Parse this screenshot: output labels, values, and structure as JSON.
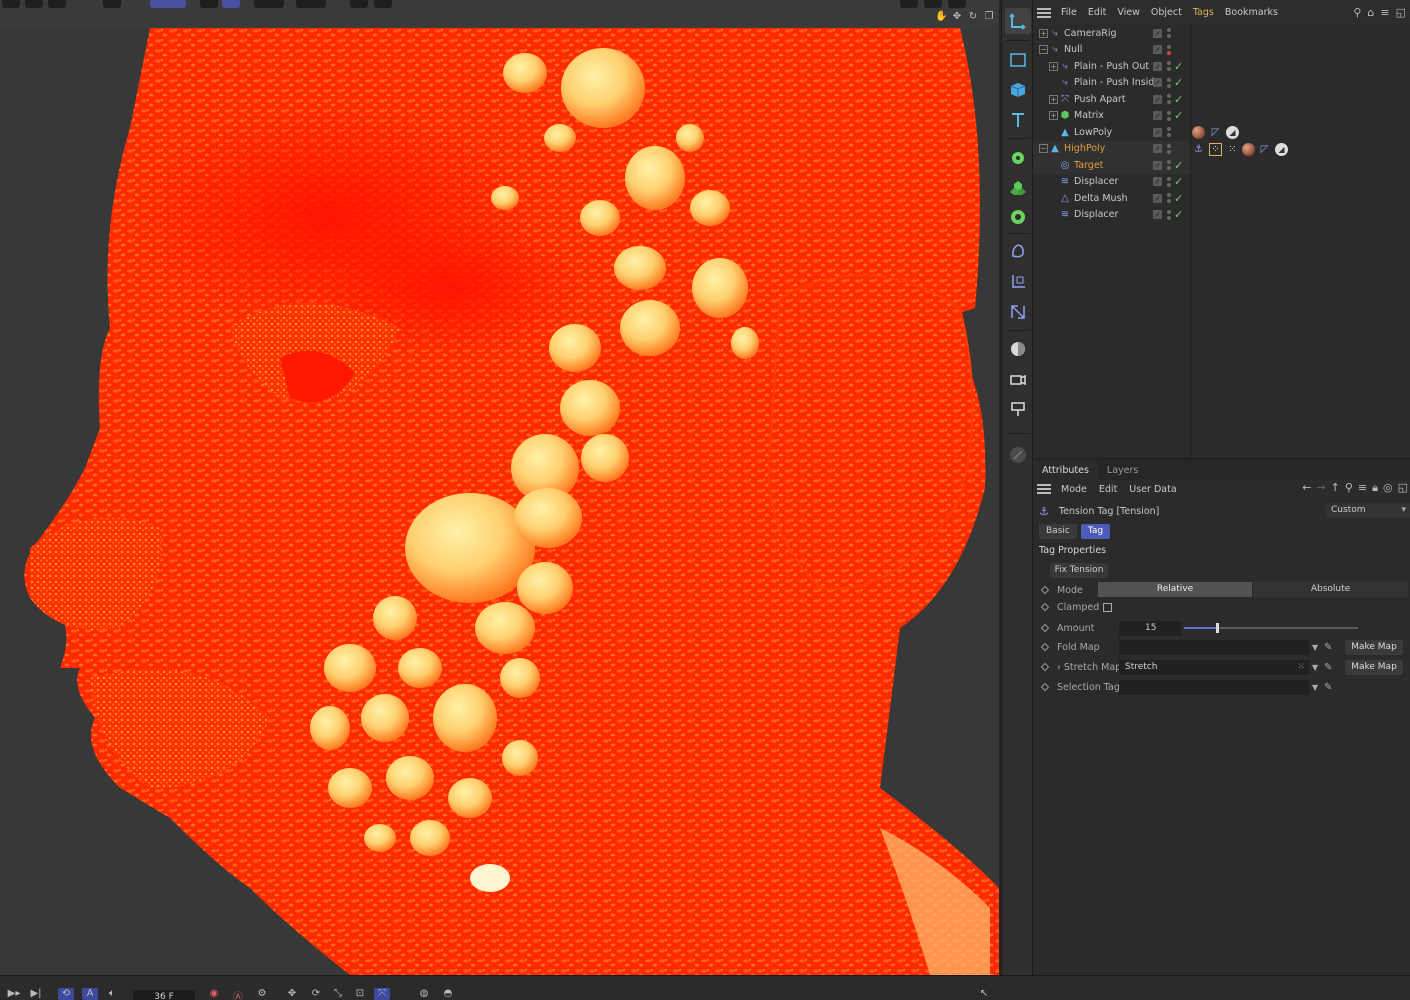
{
  "viewport": {
    "frame": "36 F"
  },
  "object_manager": {
    "menu": [
      {
        "label": "File",
        "active": false
      },
      {
        "label": "Edit",
        "active": false
      },
      {
        "label": "View",
        "active": false
      },
      {
        "label": "Object",
        "active": false
      },
      {
        "label": "Tags",
        "active": true
      },
      {
        "label": "Bookmarks",
        "active": false
      }
    ],
    "objects": [
      {
        "name": "CameraRig",
        "indent": 0,
        "expander": "+",
        "icon": "camera-rig-icon",
        "check": false,
        "red_dot": false
      },
      {
        "name": "Null",
        "indent": 0,
        "expander": "-",
        "icon": "null-icon",
        "check": false,
        "red_dot": true
      },
      {
        "name": "Plain - Push Out",
        "indent": 1,
        "expander": "+",
        "icon": "plain-effector-icon",
        "check": true,
        "red_dot": false
      },
      {
        "name": "Plain - Push Inside",
        "indent": 1,
        "expander": "",
        "icon": "plain-effector-icon",
        "check": true,
        "red_dot": false
      },
      {
        "name": "Push Apart",
        "indent": 1,
        "expander": "+",
        "icon": "push-apart-icon",
        "check": true,
        "red_dot": false
      },
      {
        "name": "Matrix",
        "indent": 1,
        "expander": "+",
        "icon": "matrix-icon",
        "check": true,
        "red_dot": false
      },
      {
        "name": "LowPoly",
        "indent": 1,
        "expander": "",
        "icon": "polygon-object-icon",
        "check": false,
        "red_dot": false
      },
      {
        "name": "HighPoly",
        "indent": 0,
        "expander": "-",
        "icon": "polygon-object-icon",
        "check": false,
        "red_dot": false,
        "highlight": true
      },
      {
        "name": "Target",
        "indent": 1,
        "expander": "",
        "icon": "target-icon",
        "check": true,
        "red_dot": false,
        "highlight": true
      },
      {
        "name": "Displacer",
        "indent": 1,
        "expander": "",
        "icon": "displacer-icon",
        "check": true,
        "red_dot": false
      },
      {
        "name": "Delta Mush",
        "indent": 1,
        "expander": "",
        "icon": "delta-mush-icon",
        "check": true,
        "red_dot": false
      },
      {
        "name": "Displacer",
        "indent": 1,
        "expander": "",
        "icon": "displacer-icon",
        "check": true,
        "red_dot": false
      }
    ]
  },
  "attributes": {
    "tabs": [
      "Attributes",
      "Layers"
    ],
    "menu": [
      "Mode",
      "Edit",
      "User Data"
    ],
    "title": "Tension Tag [Tension]",
    "preset": "Custom",
    "page_tabs": [
      {
        "label": "Basic",
        "active": false
      },
      {
        "label": "Tag",
        "active": true
      }
    ],
    "section": "Tag Properties",
    "fix_button": "Fix Tension",
    "mode": {
      "label": "Mode",
      "options": [
        "Relative",
        "Absolute"
      ],
      "selected": "Relative"
    },
    "clamped": {
      "label": "Clamped",
      "checked": false
    },
    "amount": {
      "label": "Amount",
      "value": "15",
      "slider_fraction": 0.19
    },
    "fold_map": {
      "label": "Fold Map",
      "value": "",
      "button": "Make Map"
    },
    "stretch_map": {
      "label": "Stretch Map",
      "value": "Stretch",
      "button": "Make Map"
    },
    "selection_tag": {
      "label": "Selection Tag",
      "value": ""
    }
  },
  "colors": {
    "accent_blue": "#4c5cb8",
    "tags_menu": "#e0b060",
    "highpoly_orange": "#e39a3c",
    "check_green": "#6fd06f",
    "heatmap_red": "#ff1e00",
    "heatmap_yellow": "#ffe27a"
  }
}
